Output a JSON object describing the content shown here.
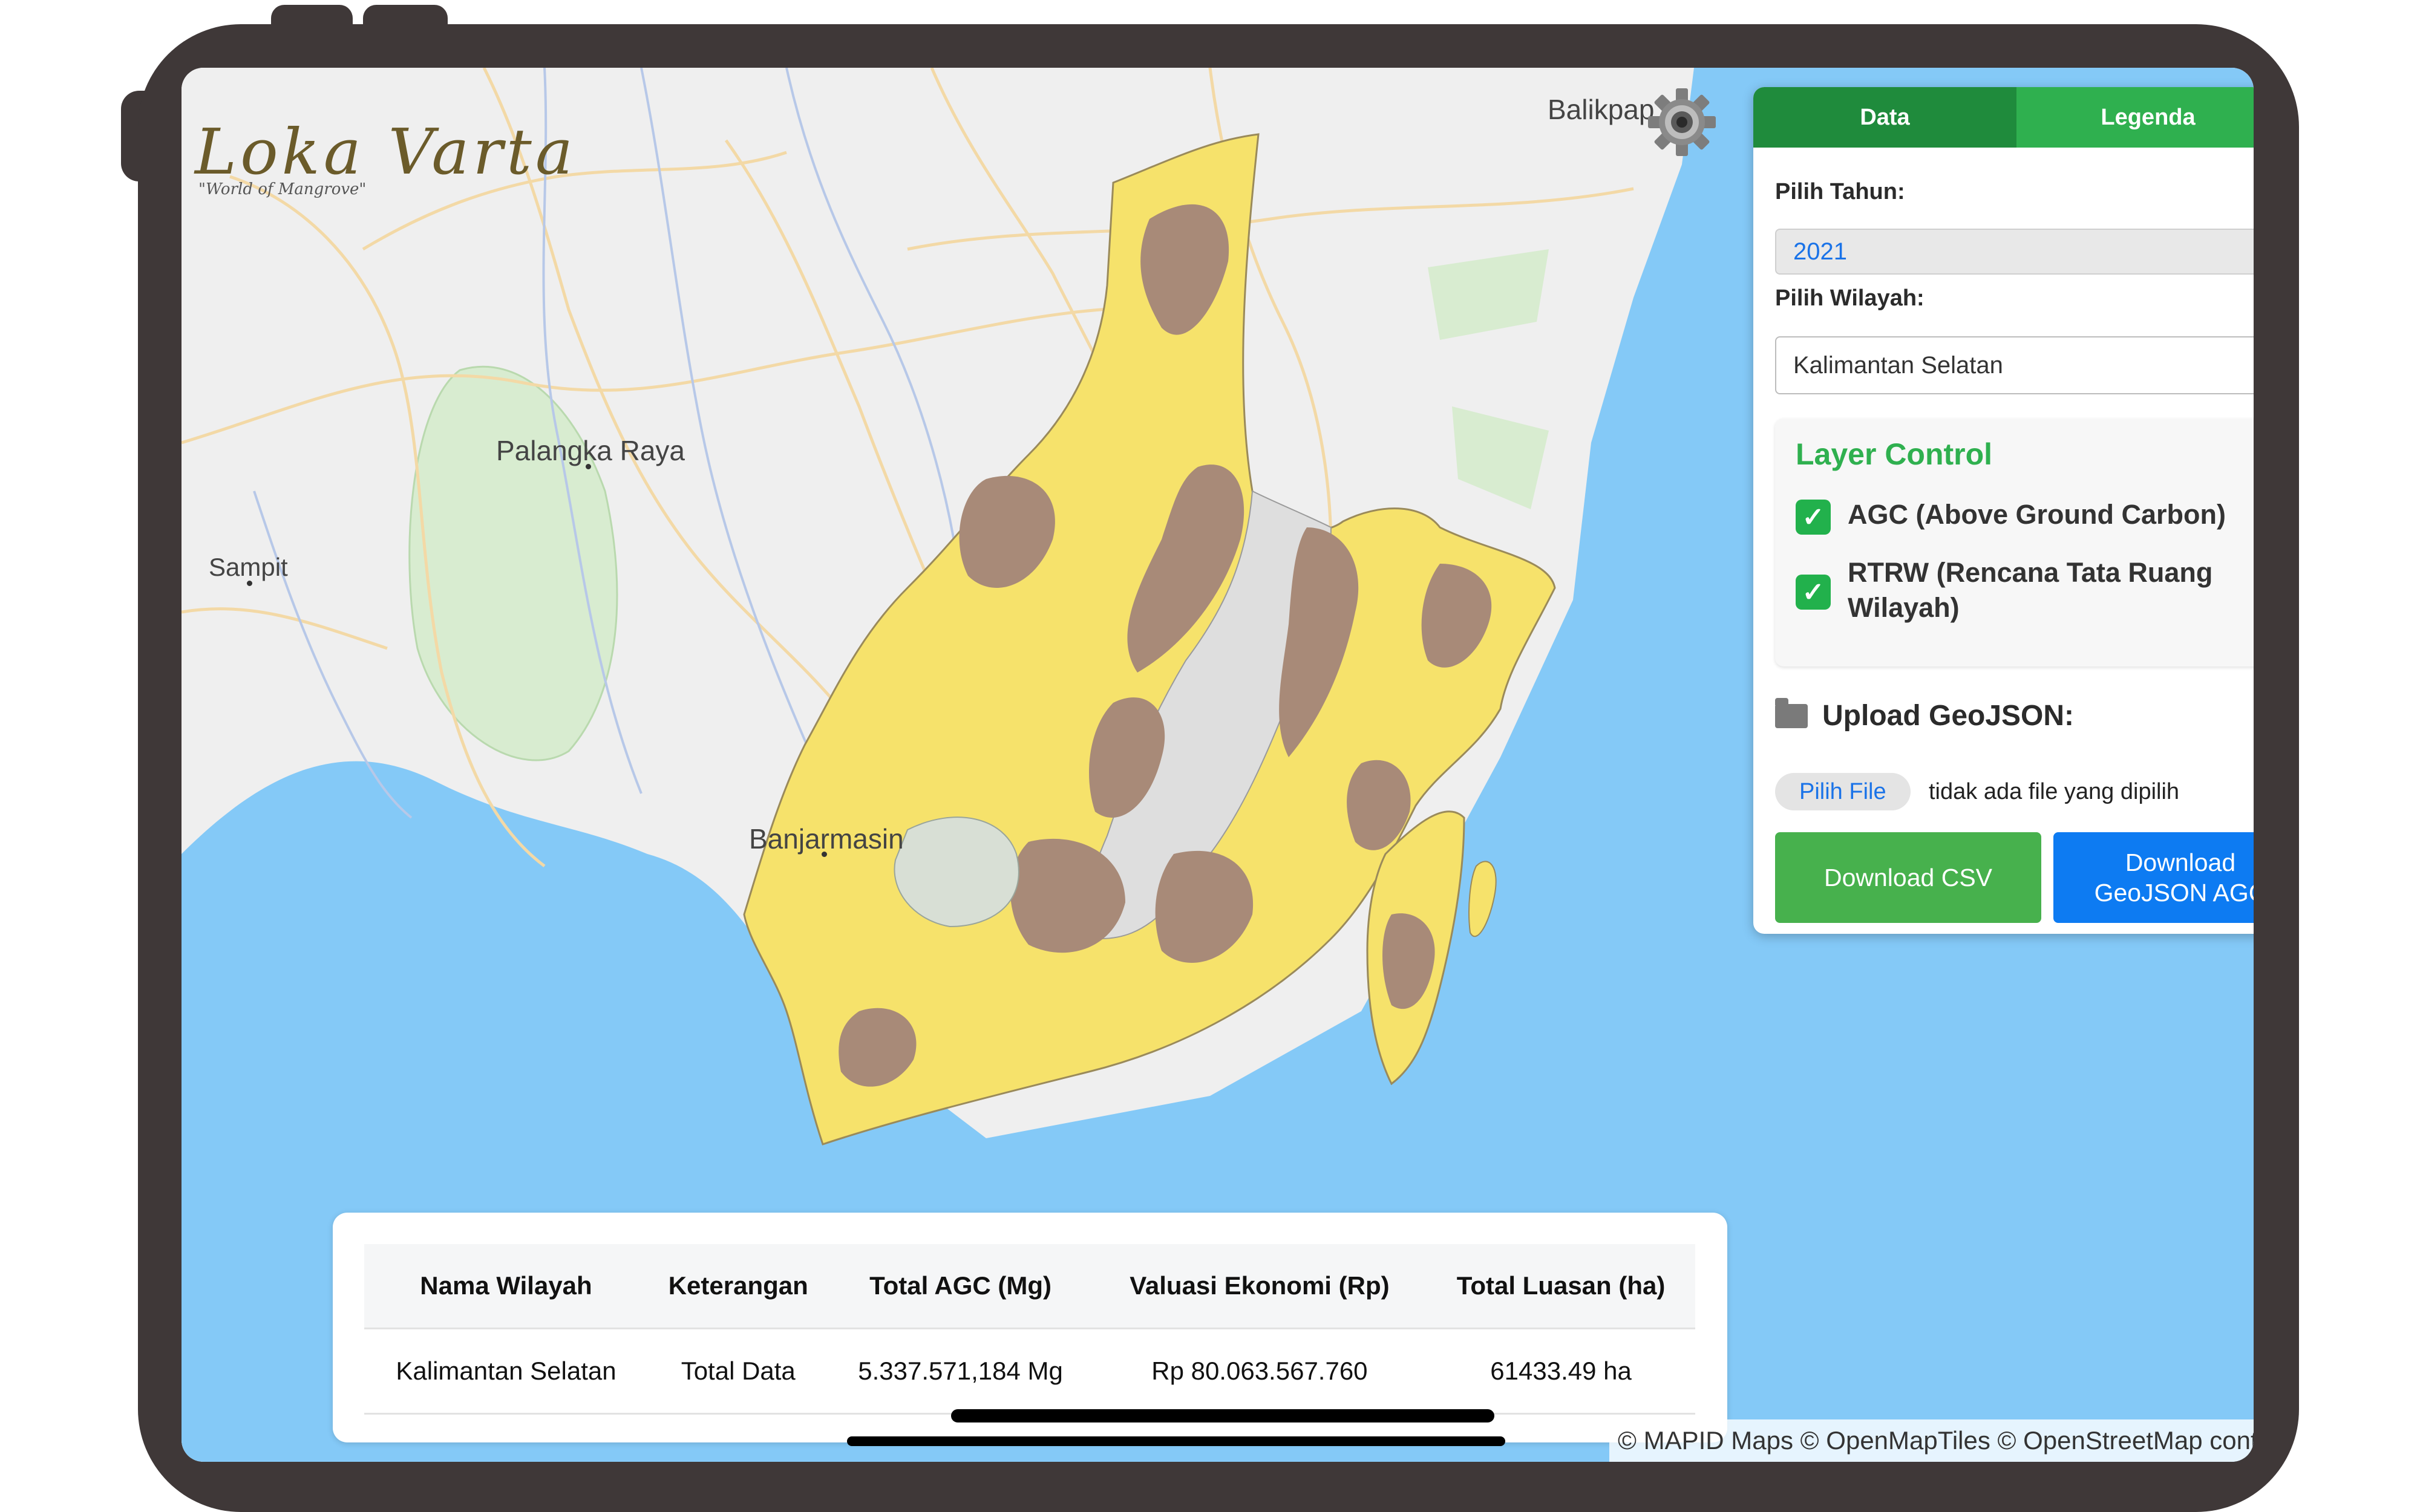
{
  "app": {
    "logo_text": "Loka Varta",
    "logo_subtitle": "\"World of Mangrove\""
  },
  "map": {
    "places": [
      {
        "name": "Balikpap"
      },
      {
        "name": "Palangka Raya"
      },
      {
        "name": "Sampit"
      },
      {
        "name": "Banjarmasin"
      }
    ],
    "attribution": "© MAPID Maps © OpenMapTiles © OpenStreetMap contributors",
    "colors": {
      "sea": "#84c9f7",
      "land": "#efefef",
      "agc_yellow": "#f6e26b",
      "agc_brown": "#a88a78",
      "rtrw_gray": "#dedede",
      "forest": "#d8ecd0"
    }
  },
  "panel": {
    "tabs": [
      {
        "label": "Data",
        "active": true
      },
      {
        "label": "Legenda",
        "active": false
      }
    ],
    "year_label": "Pilih Tahun:",
    "year_value": "2021",
    "region_label": "Pilih Wilayah:",
    "region_value": "Kalimantan Selatan",
    "layer_control": {
      "title": "Layer Control",
      "layers": [
        {
          "label": "AGC (Above Ground Carbon)",
          "checked": true
        },
        {
          "label": "RTRW (Rencana Tata Ruang Wilayah)",
          "checked": true
        }
      ]
    },
    "upload": {
      "title": "Upload GeoJSON:",
      "button": "Pilih File",
      "status": "tidak ada file yang dipilih"
    },
    "download_csv": "Download CSV",
    "download_geojson": "Download GeoJSON AGC"
  },
  "table": {
    "headers": [
      "Nama Wilayah",
      "Keterangan",
      "Total AGC (Mg)",
      "Valuasi Ekonomi (Rp)",
      "Total Luasan (ha)"
    ],
    "rows": [
      [
        "Kalimantan Selatan",
        "Total Data",
        "5.337.571,184 Mg",
        "Rp 80.063.567.760",
        "61433.49 ha"
      ]
    ]
  }
}
